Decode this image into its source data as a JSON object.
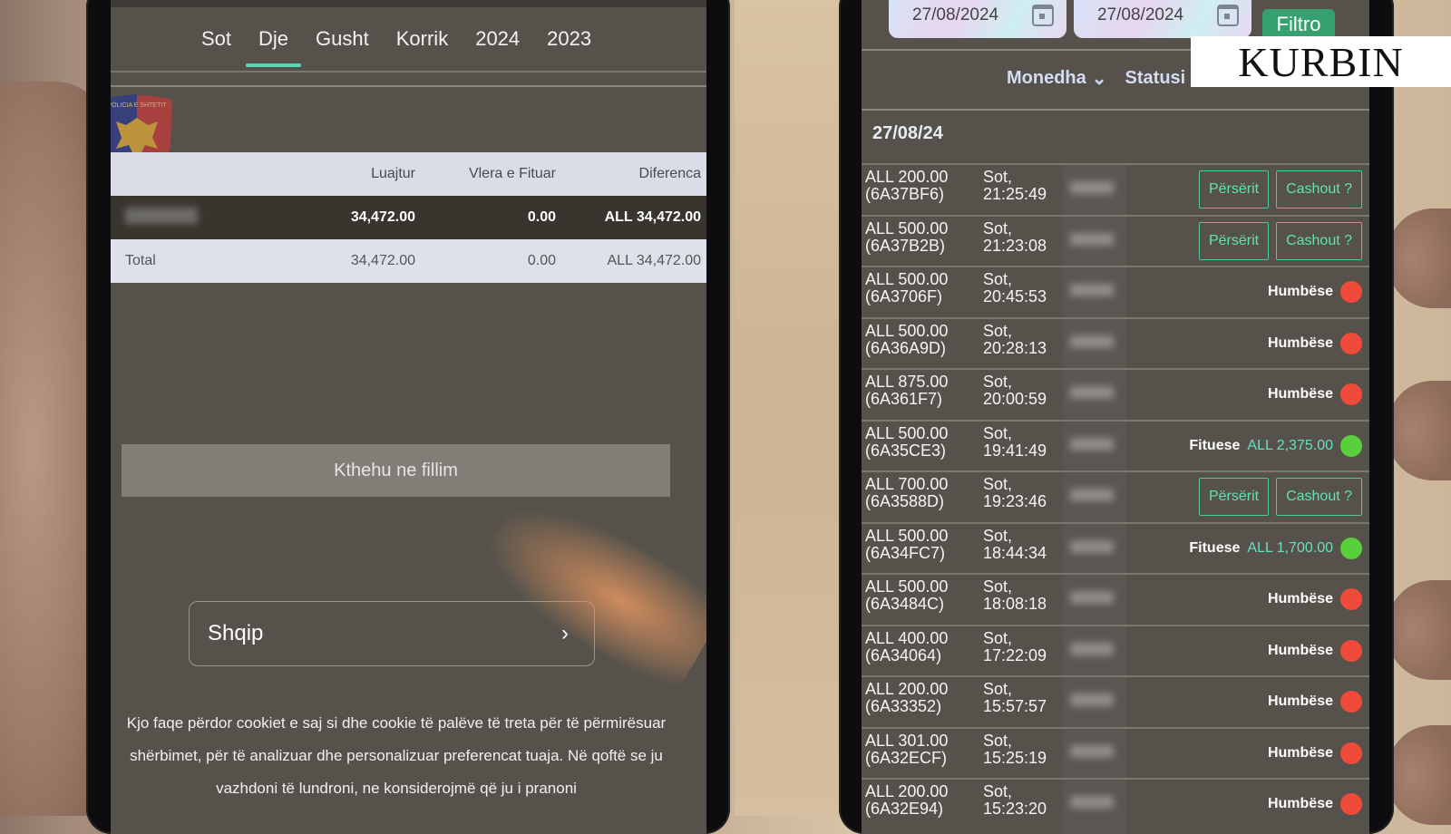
{
  "watermark": "KURBIN",
  "left_screen": {
    "tabs": [
      {
        "label": "Sot",
        "active": false
      },
      {
        "label": "Dje",
        "active": true
      },
      {
        "label": "Gusht",
        "active": false
      },
      {
        "label": "Korrik",
        "active": false
      },
      {
        "label": "2024",
        "active": false
      },
      {
        "label": "2023",
        "active": false
      }
    ],
    "badge": {
      "icon": "police-badge-icon",
      "text": "POLICIA E SHTETIT"
    },
    "summary_table": {
      "headers": [
        "",
        "Luajtur",
        "Vlera e Fituar",
        "Diferenca"
      ],
      "rows": [
        {
          "label": "",
          "luajtur": "34,472.00",
          "vlera_e_fituar": "0.00",
          "diferenca": "ALL 34,472.00"
        }
      ],
      "total": {
        "label": "Total",
        "luajtur": "34,472.00",
        "vlera_e_fituar": "0.00",
        "diferenca": "ALL 34,472.00"
      }
    },
    "back_button": "Kthehu ne fillim",
    "language": {
      "value": "Shqip",
      "icon": "chevron-right-icon"
    },
    "cookie_notice": "Kjo faqe përdor cookiet e saj si dhe cookie të palëve të treta për të përmirësuar shërbimet, për të analizuar dhe personalizuar preferencat tuaja. Në qoftë se ju vazhdoni të lundroni, ne konsiderojmë që ju i pranoni"
  },
  "right_screen": {
    "date_from": "27/08/2024",
    "date_to": "27/08/2024",
    "filter_button": "Filtro",
    "dropdowns": [
      {
        "label": "Monedha",
        "icon": "chevron-down-icon"
      },
      {
        "label": "Statusi",
        "icon": "chevron-down-icon"
      }
    ],
    "date_heading": "27/08/24",
    "colors": {
      "lost": "#f04a3a",
      "won": "#58d03a",
      "accent": "#4fc79a"
    },
    "bets": [
      {
        "amount": "ALL 200.00",
        "code": "(6A37BF6)",
        "day": "Sot,",
        "time": "21:25:49",
        "status": "open",
        "repeat": "Përsërit",
        "cashout": "Cashout ?"
      },
      {
        "amount": "ALL 500.00",
        "code": "(6A37B2B)",
        "day": "Sot,",
        "time": "21:23:08",
        "status": "open",
        "repeat": "Përsërit",
        "cashout": "Cashout ?"
      },
      {
        "amount": "ALL 500.00",
        "code": "(6A3706F)",
        "day": "Sot,",
        "time": "20:45:53",
        "status": "lost",
        "status_label": "Humbëse"
      },
      {
        "amount": "ALL 500.00",
        "code": "(6A36A9D)",
        "day": "Sot,",
        "time": "20:28:13",
        "status": "lost",
        "status_label": "Humbëse"
      },
      {
        "amount": "ALL 875.00",
        "code": "(6A361F7)",
        "day": "Sot,",
        "time": "20:00:59",
        "status": "lost",
        "status_label": "Humbëse"
      },
      {
        "amount": "ALL 500.00",
        "code": "(6A35CE3)",
        "day": "Sot,",
        "time": "19:41:49",
        "status": "won",
        "status_label": "Fituese",
        "win": "ALL 2,375.00"
      },
      {
        "amount": "ALL 700.00",
        "code": "(6A3588D)",
        "day": "Sot,",
        "time": "19:23:46",
        "status": "open",
        "repeat": "Përsërit",
        "cashout": "Cashout ?"
      },
      {
        "amount": "ALL 500.00",
        "code": "(6A34FC7)",
        "day": "Sot,",
        "time": "18:44:34",
        "status": "won",
        "status_label": "Fituese",
        "win": "ALL 1,700.00"
      },
      {
        "amount": "ALL 500.00",
        "code": "(6A3484C)",
        "day": "Sot,",
        "time": "18:08:18",
        "status": "lost",
        "status_label": "Humbëse"
      },
      {
        "amount": "ALL 400.00",
        "code": "(6A34064)",
        "day": "Sot,",
        "time": "17:22:09",
        "status": "lost",
        "status_label": "Humbëse"
      },
      {
        "amount": "ALL 200.00",
        "code": "(6A33352)",
        "day": "Sot,",
        "time": "15:57:57",
        "status": "lost",
        "status_label": "Humbëse"
      },
      {
        "amount": "ALL 301.00",
        "code": "(6A32ECF)",
        "day": "Sot,",
        "time": "15:25:19",
        "status": "lost",
        "status_label": "Humbëse"
      },
      {
        "amount": "ALL 200.00",
        "code": "(6A32E94)",
        "day": "Sot,",
        "time": "15:23:20",
        "status": "lost",
        "status_label": "Humbëse"
      }
    ]
  }
}
